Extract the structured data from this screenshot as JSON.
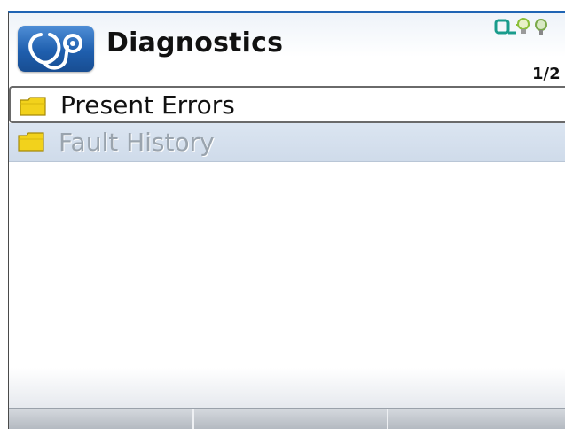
{
  "header": {
    "title": "Diagnostics",
    "app_icon": "stethoscope-icon",
    "page_indicator": "1/2"
  },
  "status_icons": [
    "connection-icon",
    "bulb-icon",
    "settings-icon"
  ],
  "menu": {
    "items": [
      {
        "label": "Present Errors",
        "icon": "folder-icon",
        "selected": true
      },
      {
        "label": "Fault History",
        "icon": "folder-icon",
        "selected": false
      }
    ]
  },
  "softkeys": [
    "",
    "",
    ""
  ],
  "colors": {
    "accent": "#1f64b4",
    "icon_background": "#2c6fbe",
    "folder": "#f2d21c",
    "list_item_background": "#d6e1ee",
    "inactive_text": "#9aa4ae"
  }
}
